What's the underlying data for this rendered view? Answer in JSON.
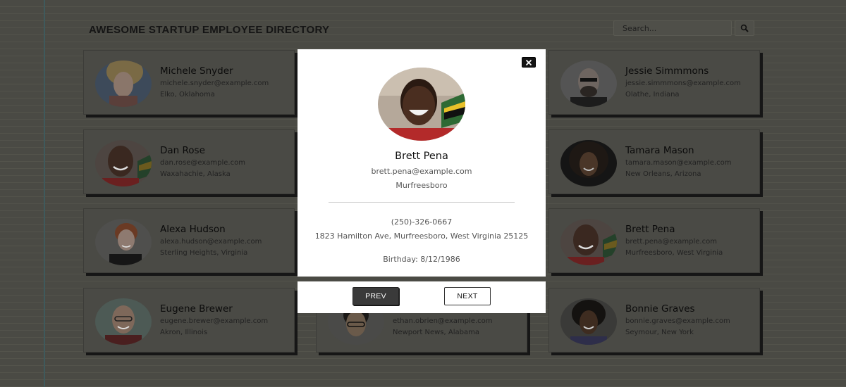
{
  "header": {
    "title": "AWESOME STARTUP EMPLOYEE DIRECTORY",
    "search_placeholder": "Search..."
  },
  "employees": [
    {
      "name": "Michele Snyder",
      "email": "michele.snyder@example.com",
      "location": "Elko, Oklahoma",
      "avatar": "woman-blonde-avatar"
    },
    {
      "name": "Jessie Simmmons",
      "email": "jessie.simmmons@example.com",
      "location": "Olathe, Indiana",
      "avatar": "man-glasses-avatar"
    },
    {
      "name": "Dan Rose",
      "email": "dan.rose@example.com",
      "location": "Waxahachie, Alaska",
      "avatar": "man-smiling-avatar"
    },
    {
      "name": "Tamara Mason",
      "email": "tamara.mason@example.com",
      "location": "New Orleans, Arizona",
      "avatar": "woman-curly-avatar"
    },
    {
      "name": "Alexa Hudson",
      "email": "alexa.hudson@example.com",
      "location": "Sterling Heights, Virginia",
      "avatar": "woman-red-hair-avatar"
    },
    {
      "name": "Brett Pena",
      "email": "brett.pena@example.com",
      "location": "Murfreesboro, West Virginia",
      "avatar": "man-smiling-avatar"
    },
    {
      "name": "Eugene Brewer",
      "email": "eugene.brewer@example.com",
      "location": "Akron, Illinois",
      "avatar": "man-glasses-avatar"
    },
    {
      "name": "",
      "email": "ethan.obrien@example.com",
      "location": "Newport News, Alabama",
      "avatar": "man-glasses-avatar"
    },
    {
      "name": "Bonnie Graves",
      "email": "bonnie.graves@example.com",
      "location": "Seymour, New York",
      "avatar": "woman-curly-avatar"
    }
  ],
  "modal": {
    "name": "Brett Pena",
    "email": "brett.pena@example.com",
    "city": "Murfreesboro",
    "phone": "(250)-326-0667",
    "address": "1823 Hamilton Ave, Murfreesboro, West Virginia 25125",
    "birthday": "Birthday: 8/12/1986",
    "close_icon": "close-icon"
  },
  "nav": {
    "prev_label": "PREV",
    "next_label": "NEXT"
  },
  "colors": {
    "overlay_bg": "#4a4a44",
    "modal_bg": "#ffffff",
    "prev_bg": "#3a3a3a"
  }
}
